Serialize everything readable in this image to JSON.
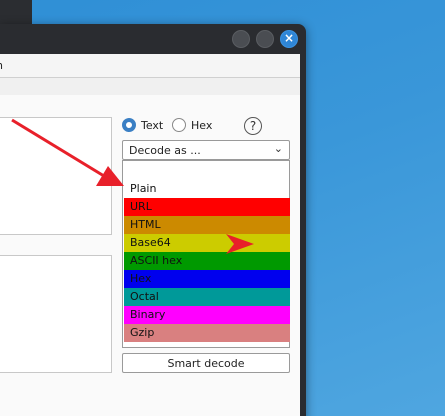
{
  "menubar": {
    "partial_label": "n"
  },
  "format_options": [
    {
      "label": "Text",
      "selected": true
    },
    {
      "label": "Hex",
      "selected": false
    }
  ],
  "help": {
    "label": "?"
  },
  "decode_combo": {
    "value": "Decode as ..."
  },
  "decode_options": [
    {
      "label": "Plain",
      "color": "#ffffff"
    },
    {
      "label": "URL",
      "color": "#ff0000"
    },
    {
      "label": "HTML",
      "color": "#cc8a00"
    },
    {
      "label": "Base64",
      "color": "#cccc00"
    },
    {
      "label": "ASCII hex",
      "color": "#009900"
    },
    {
      "label": "Hex",
      "color": "#0000ee"
    },
    {
      "label": "Octal",
      "color": "#009999"
    },
    {
      "label": "Binary",
      "color": "#ff00ff"
    },
    {
      "label": "Gzip",
      "color": "#d98080"
    }
  ],
  "smart_decode": {
    "label": "Smart decode"
  },
  "colors": {
    "annotation_arrow": "#e8202a",
    "desktop": "#3a97d9",
    "window_chrome": "#2a2c30",
    "radio_selected": "#3a7fc4"
  }
}
